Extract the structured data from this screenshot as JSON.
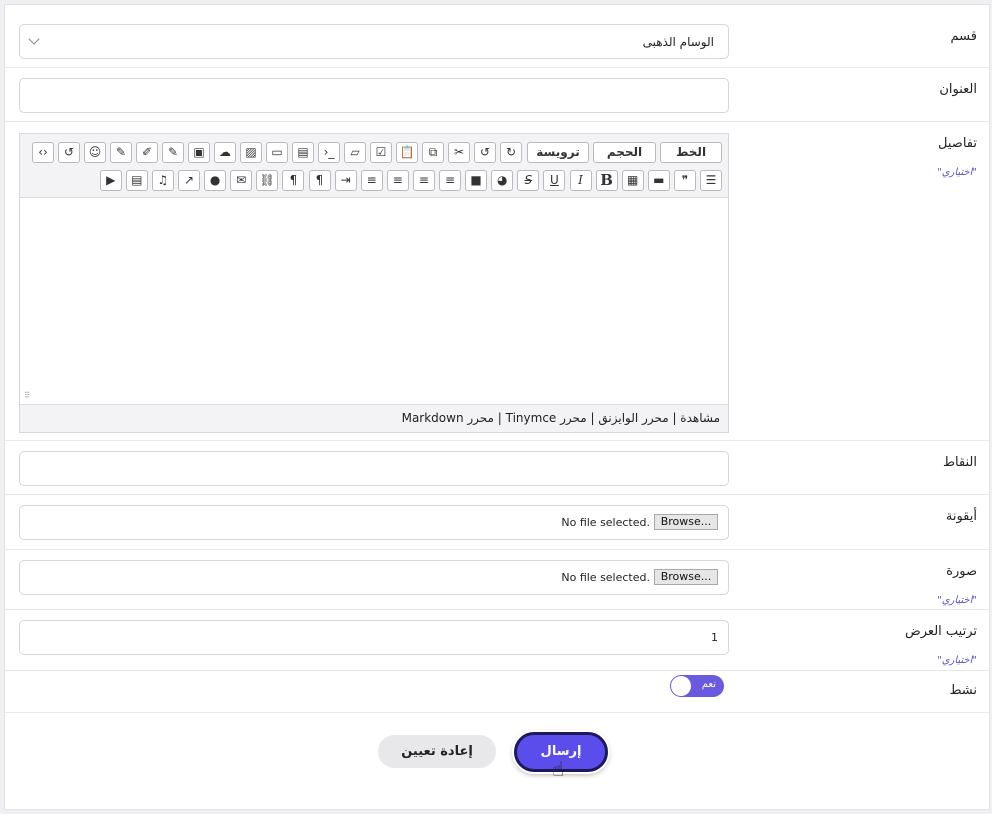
{
  "form": {
    "section": {
      "label": "قسم",
      "value": "الوسام الذهبى"
    },
    "title": {
      "label": "العنوان",
      "value": ""
    },
    "details": {
      "label": "تفاصيل",
      "optional": "\"اختياري\""
    },
    "points": {
      "label": "النقاط",
      "value": ""
    },
    "icon": {
      "label": "أيقونة",
      "browse": "Browse...",
      "nofile": "No file selected."
    },
    "image": {
      "label": "صورة",
      "optional": "\"اختياري\"",
      "browse": "Browse...",
      "nofile": "No file selected."
    },
    "order": {
      "label": "ترتيب العرض",
      "optional": "\"اختياري\"",
      "value": "1"
    },
    "active": {
      "label": "نشط",
      "toggle_text": "نعم",
      "on": true
    }
  },
  "editor": {
    "font_label": "الخط",
    "size_label": "الحجم",
    "heading_label": "ترويسة",
    "status": "مشاهدة | محرر الوايزنق | محرر Tinymce | محرر Markdown",
    "row1_icons": [
      "redo-icon",
      "undo-icon",
      "cut-icon",
      "copy-icon",
      "paste-icon",
      "checkbox-icon",
      "eraser-icon",
      "code-icon",
      "file-icon",
      "rectangle-icon",
      "image-icon",
      "upload-icon",
      "archive-icon",
      "pencil-icon",
      "edit-icon",
      "edit-box-icon",
      "smiley-icon",
      "history-icon",
      "source-code-icon"
    ],
    "row1_glyphs": [
      "↻",
      "↺",
      "✂",
      "⧉",
      "📋",
      "☑",
      "▱",
      "›_",
      "▤",
      "▭",
      "▨",
      "☁",
      "▣",
      "✎",
      "✐",
      "✎",
      "☺",
      "↺",
      "‹›"
    ],
    "row2_icons": [
      "list-icon",
      "quote-icon",
      "folder-icon",
      "qrcode-icon",
      "bold-icon",
      "italic-icon",
      "underline-icon",
      "strikethrough-icon",
      "palette-icon",
      "square-icon",
      "align-right-icon",
      "align-center-icon",
      "align-left-icon",
      "justify-icon",
      "indent-icon",
      "rtl-icon",
      "ltr-icon",
      "link-icon",
      "email-icon",
      "comment-icon",
      "external-link-icon",
      "music-icon",
      "video-clip-icon",
      "youtube-icon"
    ],
    "row2_glyphs": [
      "☰",
      "❞",
      "▬",
      "▦",
      "B",
      "I",
      "U",
      "S",
      "◕",
      "■",
      "≡",
      "≡",
      "≡",
      "≡",
      "⇥",
      "¶",
      "¶",
      "⛓",
      "✉",
      "●",
      "↗",
      "♫",
      "▤",
      "▶"
    ]
  },
  "buttons": {
    "submit": "إرسال",
    "reset": "إعادة تعيين"
  },
  "colors": {
    "accent": "#5b4cec",
    "optional_text": "#5a4fd8"
  }
}
